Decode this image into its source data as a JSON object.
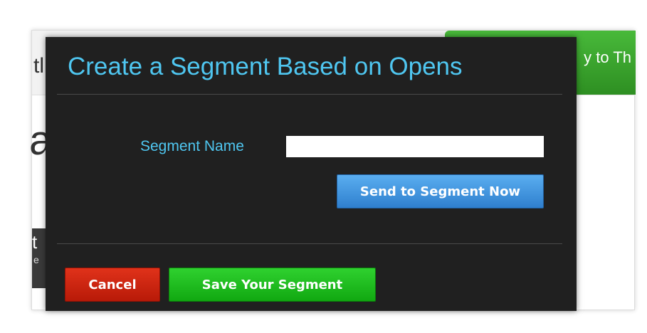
{
  "background_page": {
    "header_left_fragment": "tl",
    "header_button_fragment": "y to Th",
    "big_letter_fragment": "a",
    "dark_block_fragment_1": "t",
    "dark_block_fragment_2": "e"
  },
  "modal": {
    "title": "Create a Segment Based on Opens",
    "segment_name_label": "Segment Name",
    "segment_name_value": "",
    "send_button_label": "Send to Segment Now",
    "cancel_button_label": "Cancel",
    "save_button_label": "Save Your Segment"
  },
  "colors": {
    "modal_background": "#202020",
    "accent_text": "#4fc6f0",
    "send_button": "#3a8fd8",
    "cancel_button": "#cc2410",
    "save_button": "#1cbc1c"
  }
}
